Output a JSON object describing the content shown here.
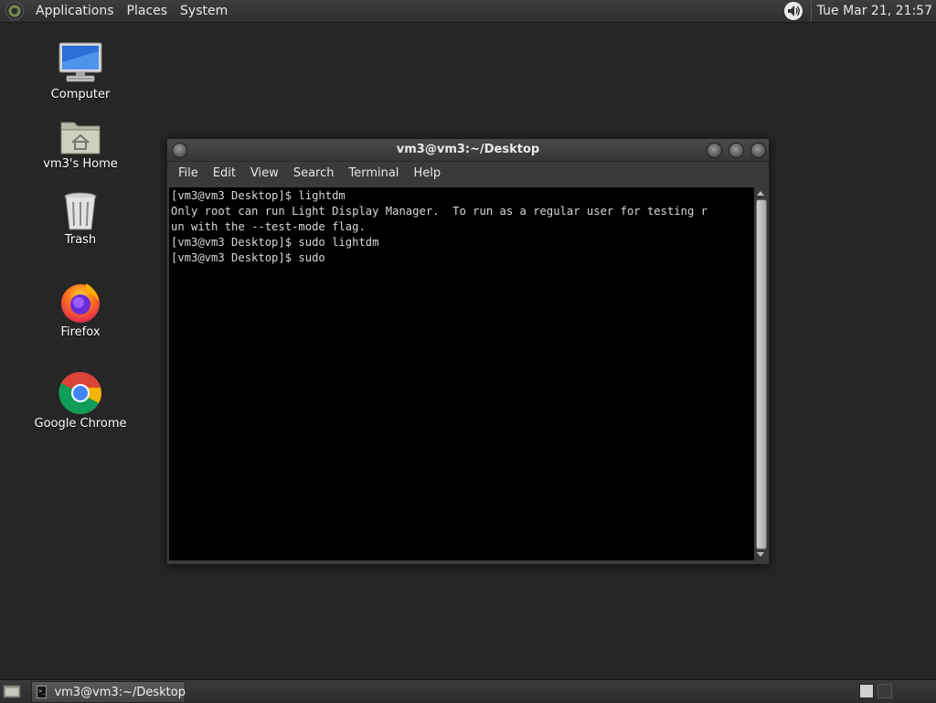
{
  "top_panel": {
    "menus": [
      "Applications",
      "Places",
      "System"
    ],
    "clock": "Tue Mar 21, 21:57"
  },
  "desktop": {
    "icons": [
      {
        "label": "Computer",
        "icon": "computer-icon"
      },
      {
        "label": "vm3's Home",
        "icon": "home-folder-icon"
      },
      {
        "label": "Trash",
        "icon": "trash-icon"
      },
      {
        "label": "Firefox",
        "icon": "firefox-icon"
      },
      {
        "label": "Google Chrome",
        "icon": "chrome-icon"
      }
    ]
  },
  "terminal": {
    "title": "vm3@vm3:~/Desktop",
    "menu": [
      "File",
      "Edit",
      "View",
      "Search",
      "Terminal",
      "Help"
    ],
    "lines": [
      "[vm3@vm3 Desktop]$ lightdm",
      "Only root can run Light Display Manager.  To run as a regular user for testing r",
      "un with the --test-mode flag.",
      "[vm3@vm3 Desktop]$ sudo lightdm",
      "[vm3@vm3 Desktop]$ sudo "
    ]
  },
  "taskbar": {
    "task_label": "vm3@vm3:~/Desktop"
  }
}
